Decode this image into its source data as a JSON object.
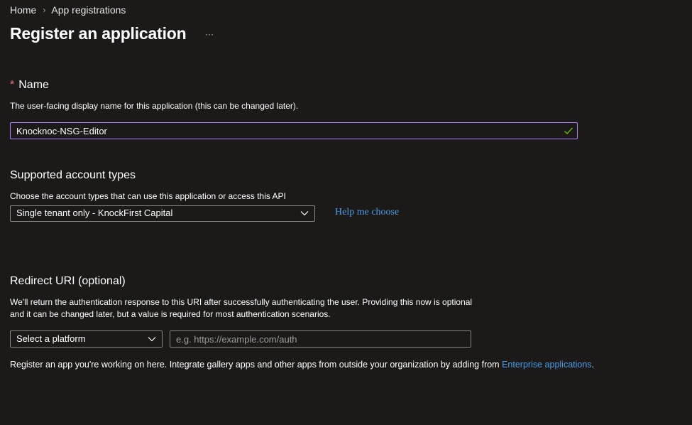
{
  "breadcrumb": {
    "home": "Home",
    "separator": "›",
    "current": "App registrations"
  },
  "page": {
    "title": "Register an application",
    "more_label": "···"
  },
  "name_section": {
    "required_mark": "*",
    "title": "Name",
    "description": "The user-facing display name for this application (this can be changed later).",
    "value": "Knocknoc-NSG-Editor",
    "valid_icon": "check-icon"
  },
  "account_types": {
    "title": "Supported account types",
    "description": "Choose the account types that can use this application or access this API",
    "selected": "Single tenant only - KnockFirst Capital",
    "help_link": "Help me choose"
  },
  "redirect_uri": {
    "title": "Redirect URI (optional)",
    "description": "We'll return the authentication response to this URI after successfully authenticating the user. Providing this now is optional and it can be changed later, but a value is required for most authentication scenarios.",
    "platform_selected": "Select a platform",
    "uri_placeholder": "e.g. https://example.com/auth",
    "uri_value": ""
  },
  "footer": {
    "text": "Register an app you're working on here. Integrate gallery apps and other apps from outside your organization by adding from",
    "link": "Enterprise applications",
    "end": "."
  },
  "colors": {
    "background": "#1b1a19",
    "accent_link": "#4f9ce8",
    "focus_border": "#b283ff",
    "valid_check": "#6bb700",
    "required_star": "#f1707b"
  }
}
